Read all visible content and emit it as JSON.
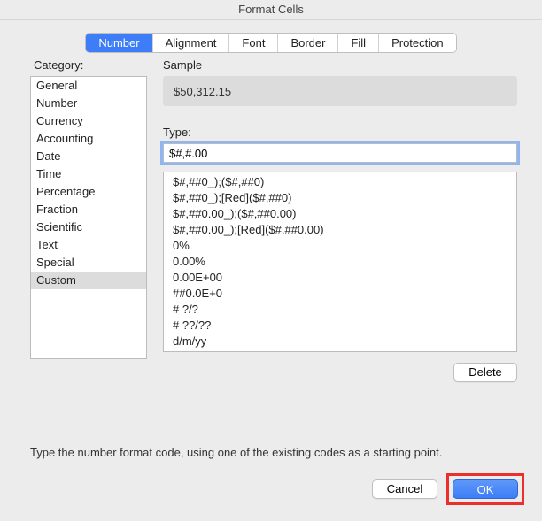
{
  "window": {
    "title": "Format Cells"
  },
  "tabs": [
    {
      "label": "Number"
    },
    {
      "label": "Alignment"
    },
    {
      "label": "Font"
    },
    {
      "label": "Border"
    },
    {
      "label": "Fill"
    },
    {
      "label": "Protection"
    }
  ],
  "labels": {
    "category": "Category:",
    "sample": "Sample",
    "type": "Type:",
    "help": "Type the number format code, using one of the existing codes as a starting point."
  },
  "categories": [
    "General",
    "Number",
    "Currency",
    "Accounting",
    "Date",
    "Time",
    "Percentage",
    "Fraction",
    "Scientific",
    "Text",
    "Special",
    "Custom"
  ],
  "sample_value": "$50,312.15",
  "type_value": "$#,#.00",
  "format_list": [
    "$#,##0_);($#,##0)",
    "$#,##0_);[Red]($#,##0)",
    "$#,##0.00_);($#,##0.00)",
    "$#,##0.00_);[Red]($#,##0.00)",
    "0%",
    "0.00%",
    "0.00E+00",
    "##0.0E+0",
    "# ?/?",
    "# ??/??",
    "d/m/yy"
  ],
  "buttons": {
    "delete": "Delete",
    "cancel": "Cancel",
    "ok": "OK"
  }
}
